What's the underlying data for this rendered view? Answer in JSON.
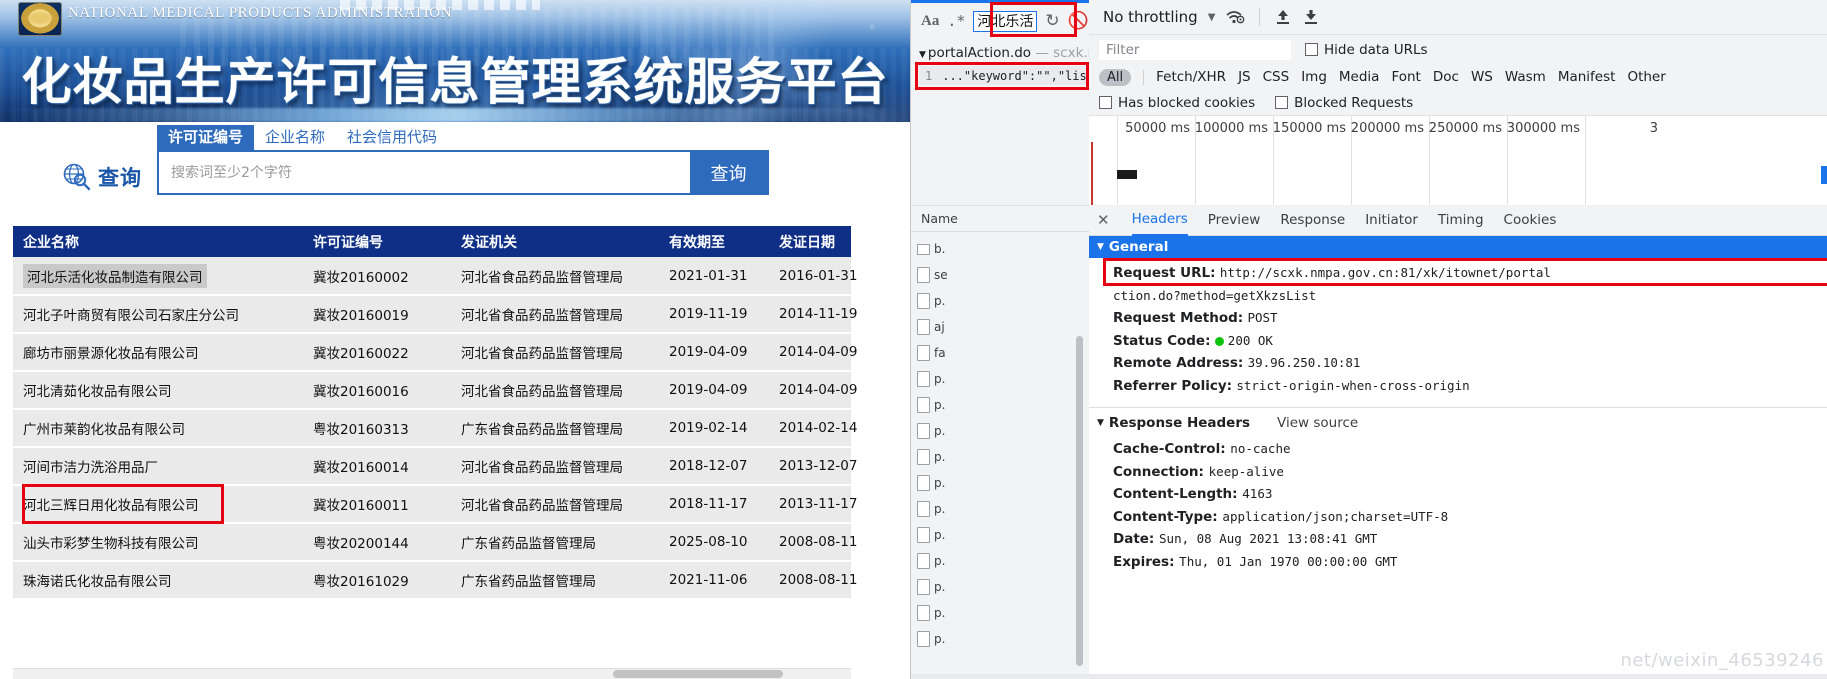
{
  "site": {
    "agency_en": "NATIONAL MEDICAL PRODUCTS ADMINISTRATION",
    "title_cn": "化妆品生产许可信息管理系统服务平台"
  },
  "search": {
    "globe_label": "查询",
    "tabs": [
      {
        "label": "许可证编号",
        "active": true
      },
      {
        "label": "企业名称",
        "active": false
      },
      {
        "label": "社会信用代码",
        "active": false
      }
    ],
    "input_value": "",
    "placeholder": "搜索词至少2个字符",
    "button_label": "查询"
  },
  "table": {
    "columns": [
      "企业名称",
      "许可证编号",
      "发证机关",
      "有效期至",
      "发证日期"
    ],
    "rows": [
      {
        "name": "河北乐活化妆品制造有限公司",
        "license": "冀妆20160002",
        "org": "河北省食品药品监督管理局",
        "valid_to": "2021-01-31",
        "issued": "2016-01-31",
        "highlighted": true
      },
      {
        "name": "河北子叶商贸有限公司石家庄分公司",
        "license": "冀妆20160019",
        "org": "河北省食品药品监督管理局",
        "valid_to": "2019-11-19",
        "issued": "2014-11-19",
        "highlighted": false
      },
      {
        "name": "廊坊市丽景源化妆品有限公司",
        "license": "冀妆20160022",
        "org": "河北省食品药品监督管理局",
        "valid_to": "2019-04-09",
        "issued": "2014-04-09",
        "highlighted": false
      },
      {
        "name": "河北清茹化妆品有限公司",
        "license": "冀妆20160016",
        "org": "河北省食品药品监督管理局",
        "valid_to": "2019-04-09",
        "issued": "2014-04-09",
        "highlighted": false
      },
      {
        "name": "广州市莱韵化妆品有限公司",
        "license": "粤妆20160313",
        "org": "广东省食品药品监督管理局",
        "valid_to": "2019-02-14",
        "issued": "2014-02-14",
        "highlighted": false
      },
      {
        "name": "河间市洁力洗浴用品厂",
        "license": "冀妆20160014",
        "org": "河北省食品药品监督管理局",
        "valid_to": "2018-12-07",
        "issued": "2013-12-07",
        "highlighted": false
      },
      {
        "name": "河北三辉日用化妆品有限公司",
        "license": "冀妆20160011",
        "org": "河北省食品药品监督管理局",
        "valid_to": "2018-11-17",
        "issued": "2013-11-17",
        "highlighted": false
      },
      {
        "name": "汕头市彩梦生物科技有限公司",
        "license": "粤妆20200144",
        "org": "广东省药品监督管理局",
        "valid_to": "2025-08-10",
        "issued": "2008-08-11",
        "highlighted": false
      },
      {
        "name": "珠海诺氏化妆品有限公司",
        "license": "粤妆20161029",
        "org": "广东省药品监督管理局",
        "valid_to": "2021-11-06",
        "issued": "2008-08-11",
        "highlighted": false
      }
    ]
  },
  "devtools": {
    "sources": {
      "match_case_label": "Aa",
      "regex_label": ".*",
      "find_value": "河北乐活",
      "refresh_icon": "refresh-icon",
      "cancel_icon": "no-entry-icon",
      "file_name": "portalAction.do",
      "file_host": "scxk.n...",
      "line_number": "1",
      "line_preview": "...\"keyword\":\"\",\"list\":[{\"l..."
    },
    "network_toolbar": {
      "throttling": "No throttling",
      "wifi_icon": "wifi-settings-icon",
      "upload_icon": "import-har-icon",
      "download_icon": "export-har-icon"
    },
    "filter_row": {
      "placeholder": "Filter",
      "hide_data_urls": "Hide data URLs",
      "types": [
        "All",
        "Fetch/XHR",
        "JS",
        "CSS",
        "Img",
        "Media",
        "Font",
        "Doc",
        "WS",
        "Wasm",
        "Manifest",
        "Other"
      ],
      "active_type": "All",
      "has_blocked_cookies": "Has blocked cookies",
      "blocked_requests": "Blocked Requests"
    },
    "overview": {
      "ticks": [
        "50000 ms",
        "100000 ms",
        "150000 ms",
        "200000 ms",
        "250000 ms",
        "300000 ms",
        "3"
      ]
    },
    "request_list": {
      "column_header": "Name",
      "items": [
        "b.",
        "se",
        "p.",
        "aj",
        "fa",
        "p.",
        "p.",
        "p.",
        "p.",
        "p.",
        "p.",
        "p.",
        "p.",
        "p.",
        "p.",
        "p."
      ]
    },
    "panel_tabs": [
      {
        "label": "Headers",
        "active": true
      },
      {
        "label": "Preview",
        "active": false
      },
      {
        "label": "Response",
        "active": false
      },
      {
        "label": "Initiator",
        "active": false
      },
      {
        "label": "Timing",
        "active": false
      },
      {
        "label": "Cookies",
        "active": false
      }
    ],
    "general": {
      "section_title": "General",
      "request_url_key": "Request URL:",
      "request_url_line1": "http://scxk.nmpa.gov.cn:81/xk/itownet/portal",
      "request_url_line2": "ction.do?method=getXkzsList",
      "request_method_key": "Request Method:",
      "request_method": "POST",
      "status_code_key": "Status Code:",
      "status_code": "200 OK",
      "remote_address_key": "Remote Address:",
      "remote_address": "39.96.250.10:81",
      "referrer_policy_key": "Referrer Policy:",
      "referrer_policy": "strict-origin-when-cross-origin"
    },
    "response_headers": {
      "section_title": "Response Headers",
      "view_source": "View source",
      "items": [
        {
          "key": "Cache-Control:",
          "value": "no-cache"
        },
        {
          "key": "Connection:",
          "value": "keep-alive"
        },
        {
          "key": "Content-Length:",
          "value": "4163"
        },
        {
          "key": "Content-Type:",
          "value": "application/json;charset=UTF-8"
        },
        {
          "key": "Date:",
          "value": "Sun, 08 Aug 2021 13:08:41 GMT"
        },
        {
          "key": "Expires:",
          "value": "Thu, 01 Jan 1970 00:00:00 GMT"
        }
      ]
    },
    "watermark": "net/weixin_46539246"
  },
  "colors": {
    "brand_blue": "#2f6bbd",
    "table_header": "#0e2f85",
    "annotation_red": "#e60012",
    "devtools_accent": "#1a73e8",
    "status_ok": "#0ac30a"
  }
}
